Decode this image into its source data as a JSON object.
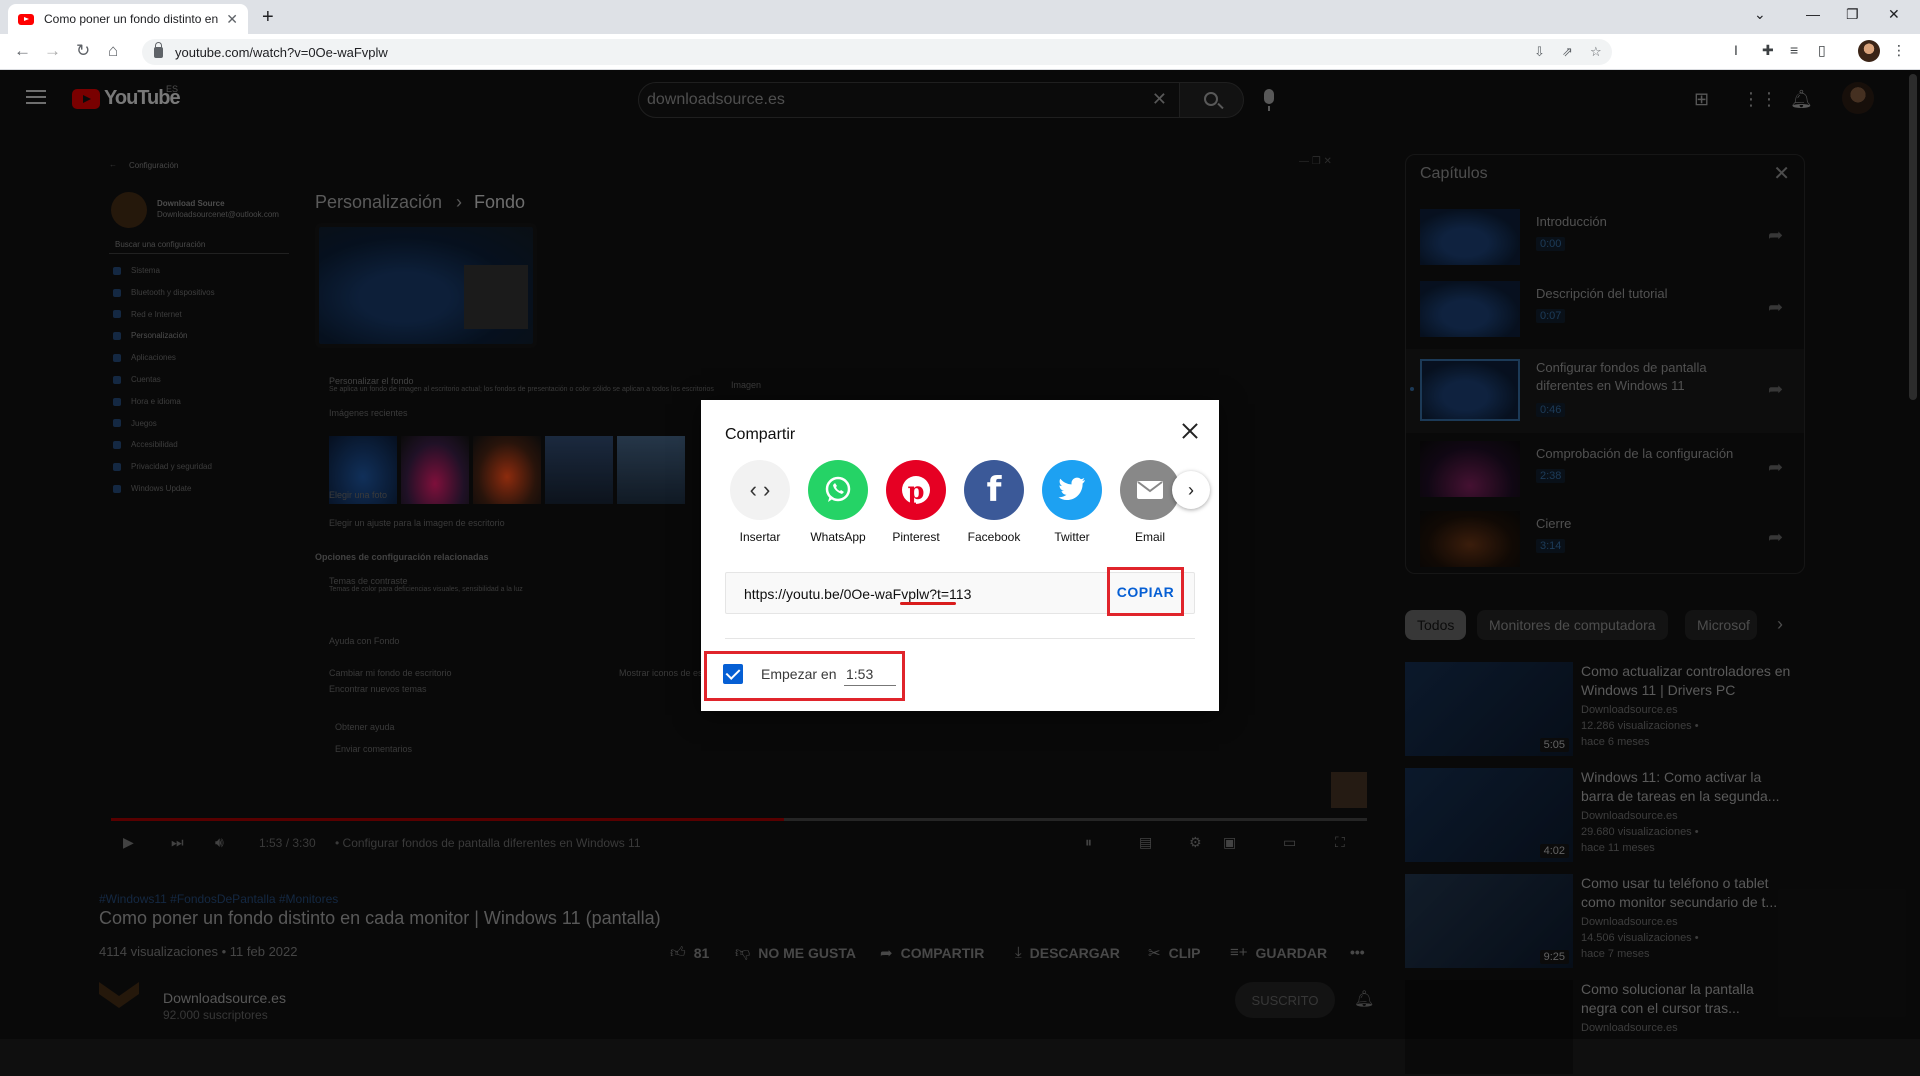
{
  "browser": {
    "tab_title": "Como poner un fondo distinto en",
    "url": "youtube.com/watch?v=0Oe-waFvplw"
  },
  "youtube": {
    "logo_text": "YouTube",
    "country_code": "ES",
    "search_value": "downloadsource.es"
  },
  "video_overlay": {
    "breadcrumb_section": "Personalización",
    "breadcrumb_page": "Fondo",
    "settings_title": "Configuración",
    "account_name": "Download Source",
    "account_email": "Downloadsourcenet@outlook.com",
    "search_placeholder": "Buscar una configuración",
    "menu": [
      "Sistema",
      "Bluetooth y dispositivos",
      "Red e Internet",
      "Personalización",
      "Aplicaciones",
      "Cuentas",
      "Hora e idioma",
      "Juegos",
      "Accesibilidad",
      "Privacidad y seguridad",
      "Windows Update"
    ],
    "personalize_bg": "Personalizar el fondo",
    "personalize_bg_desc": "Se aplica un fondo de imagen al escritorio actual; los fondos de presentación o color sólido se aplican a todos los escritorios",
    "bg_type": "Imagen",
    "recent_images": "Imágenes recientes",
    "choose_photo": "Elegir una foto",
    "choose_fit": "Elegir un ajuste para la imagen de escritorio",
    "related_settings": "Opciones de configuración relacionadas",
    "contrast_themes": "Temas de contraste",
    "contrast_desc": "Temas de color para deficiencias visuales, sensibilidad a la luz",
    "help_bg": "Ayuda con Fondo",
    "help_link_1": "Cambiar mi fondo de escritorio",
    "help_link_2": "Mostrar iconos de escritorio",
    "help_link_3": "Encontrar nuevos temas",
    "get_help": "Obtener ayuda",
    "send_feedback": "Enviar comentarios",
    "time": "1:53 / 3:30",
    "chapter": "• Configurar fondos de pantalla diferentes en Windows 11",
    "progress_percent": 53.6
  },
  "chapters": {
    "header": "Capítulos",
    "items": [
      {
        "title": "Introducción",
        "time": "0:00"
      },
      {
        "title": "Descripción del tutorial",
        "time": "0:07"
      },
      {
        "title": "Configurar fondos de pantalla diferentes en Windows 11",
        "time": "0:46"
      },
      {
        "title": "Comprobación de la configuración",
        "time": "2:38"
      },
      {
        "title": "Cierre",
        "time": "3:14"
      }
    ]
  },
  "chips": [
    "Todos",
    "Monitores de computadora",
    "Microsof"
  ],
  "recommended": [
    {
      "title": "Como actualizar controladores en Windows 11 | Drivers PC",
      "channel": "Downloadsource.es",
      "views": "12.286 visualizaciones •",
      "age": "hace 6 meses",
      "duration": "5:05"
    },
    {
      "title": "Windows 11: Como activar la barra de tareas en la segunda...",
      "channel": "Downloadsource.es",
      "views": "29.680 visualizaciones •",
      "age": "hace 11 meses",
      "duration": "4:02"
    },
    {
      "title": "Como usar tu teléfono o tablet como monitor secundario de t...",
      "channel": "Downloadsource.es",
      "views": "14.506 visualizaciones •",
      "age": "hace 7 meses",
      "duration": "9:25"
    },
    {
      "title": "Como solucionar la pantalla negra con el cursor tras...",
      "channel": "Downloadsource.es",
      "views": "",
      "age": "",
      "duration": ""
    }
  ],
  "video": {
    "hashtags": "#Windows11 #FondosDePantalla #Monitores",
    "title": "Como poner un fondo distinto en cada monitor | Windows 11 (pantalla)",
    "views_date": "4114 visualizaciones • 11 feb 2022",
    "likes": "81",
    "dislike": "NO ME GUSTA",
    "share": "COMPARTIR",
    "download": "DESCARGAR",
    "clip": "CLIP",
    "save": "GUARDAR",
    "more": "•••",
    "channel": "Downloadsource.es",
    "subscribers": "92.000 suscriptores",
    "subscribed": "SUSCRITO"
  },
  "share_dialog": {
    "title": "Compartir",
    "targets": [
      {
        "label": "Insertar",
        "icon": "embed-icon",
        "color": "#f2f2f2"
      },
      {
        "label": "WhatsApp",
        "icon": "whatsapp-icon",
        "color": "#25d366"
      },
      {
        "label": "Pinterest",
        "icon": "pinterest-icon",
        "color": "#e60023"
      },
      {
        "label": "Facebook",
        "icon": "facebook-icon",
        "color": "#3b5998"
      },
      {
        "label": "Twitter",
        "icon": "twitter-icon",
        "color": "#1da1f2"
      },
      {
        "label": "Email",
        "icon": "email-icon",
        "color": "#888888"
      }
    ],
    "link": "https://youtu.be/0Oe-waFvplw?t=113",
    "copy_label": "COPIAR",
    "start_label": "Empezar en",
    "start_time": "1:53",
    "start_checked": true
  }
}
